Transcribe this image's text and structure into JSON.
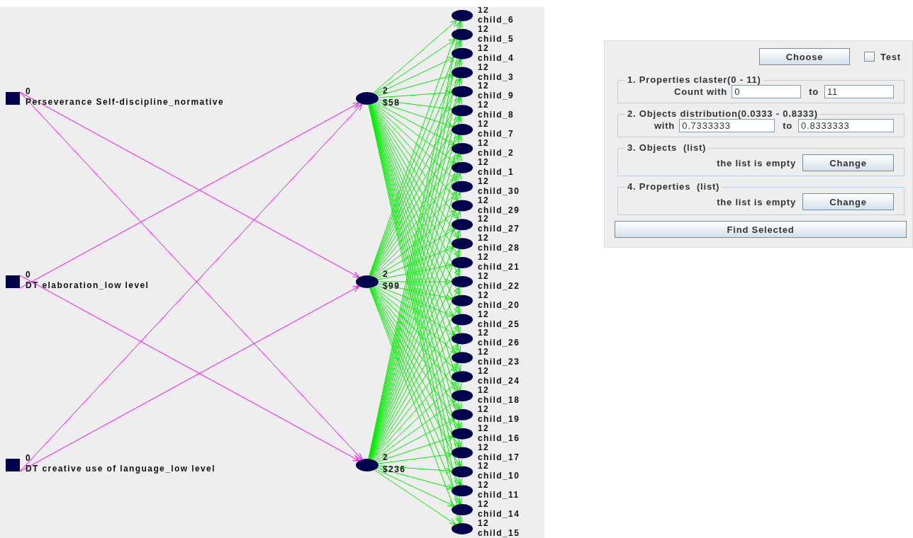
{
  "graph": {
    "sources": [
      {
        "count": "0",
        "label": "Perseverance Self-discipline_normative"
      },
      {
        "count": "0",
        "label": "DT elaboration_low level"
      },
      {
        "count": "0",
        "label": "DT creative use of language_low level"
      }
    ],
    "clusters": [
      {
        "count": "2",
        "label": "$58"
      },
      {
        "count": "2",
        "label": "$99"
      },
      {
        "count": "2",
        "label": "$236"
      }
    ],
    "children": [
      {
        "count": "12",
        "label": "child_6"
      },
      {
        "count": "12",
        "label": "child_5"
      },
      {
        "count": "12",
        "label": "child_4"
      },
      {
        "count": "12",
        "label": "child_3"
      },
      {
        "count": "12",
        "label": "child_9"
      },
      {
        "count": "12",
        "label": "child_8"
      },
      {
        "count": "12",
        "label": "child_7"
      },
      {
        "count": "12",
        "label": "child_2"
      },
      {
        "count": "12",
        "label": "child_1"
      },
      {
        "count": "12",
        "label": "child_30"
      },
      {
        "count": "12",
        "label": "child_29"
      },
      {
        "count": "12",
        "label": "child_27"
      },
      {
        "count": "12",
        "label": "child_28"
      },
      {
        "count": "12",
        "label": "child_21"
      },
      {
        "count": "12",
        "label": "child_22"
      },
      {
        "count": "12",
        "label": "child_20"
      },
      {
        "count": "12",
        "label": "child_25"
      },
      {
        "count": "12",
        "label": "child_26"
      },
      {
        "count": "12",
        "label": "child_23"
      },
      {
        "count": "12",
        "label": "child_24"
      },
      {
        "count": "12",
        "label": "child_18"
      },
      {
        "count": "12",
        "label": "child_19"
      },
      {
        "count": "12",
        "label": "child_16"
      },
      {
        "count": "12",
        "label": "child_17"
      },
      {
        "count": "12",
        "label": "child_10"
      },
      {
        "count": "12",
        "label": "child_11"
      },
      {
        "count": "12",
        "label": "child_14"
      },
      {
        "count": "12",
        "label": "child_15"
      }
    ]
  },
  "panel": {
    "choose_button": "Choose",
    "test": {
      "label": "Test",
      "checked": false
    },
    "groups": [
      {
        "kind": "range",
        "title": "1. Properties claster(0 - 11)",
        "label": "Count with",
        "from": "0",
        "to_label": "to",
        "to": "11"
      },
      {
        "kind": "range",
        "title": "2. Objects distribution(0.0333 - 0.8333)",
        "label": "with",
        "from": "0.7333333",
        "to_label": "to",
        "to": "0.8333333"
      },
      {
        "kind": "list",
        "title": "3. Objects  (list)",
        "status": "the list is empty",
        "button": "Change"
      },
      {
        "kind": "list",
        "title": "4. Properties  (list)",
        "status": "the list is empty",
        "button": "Change"
      }
    ],
    "find_button": "Find Selected"
  }
}
